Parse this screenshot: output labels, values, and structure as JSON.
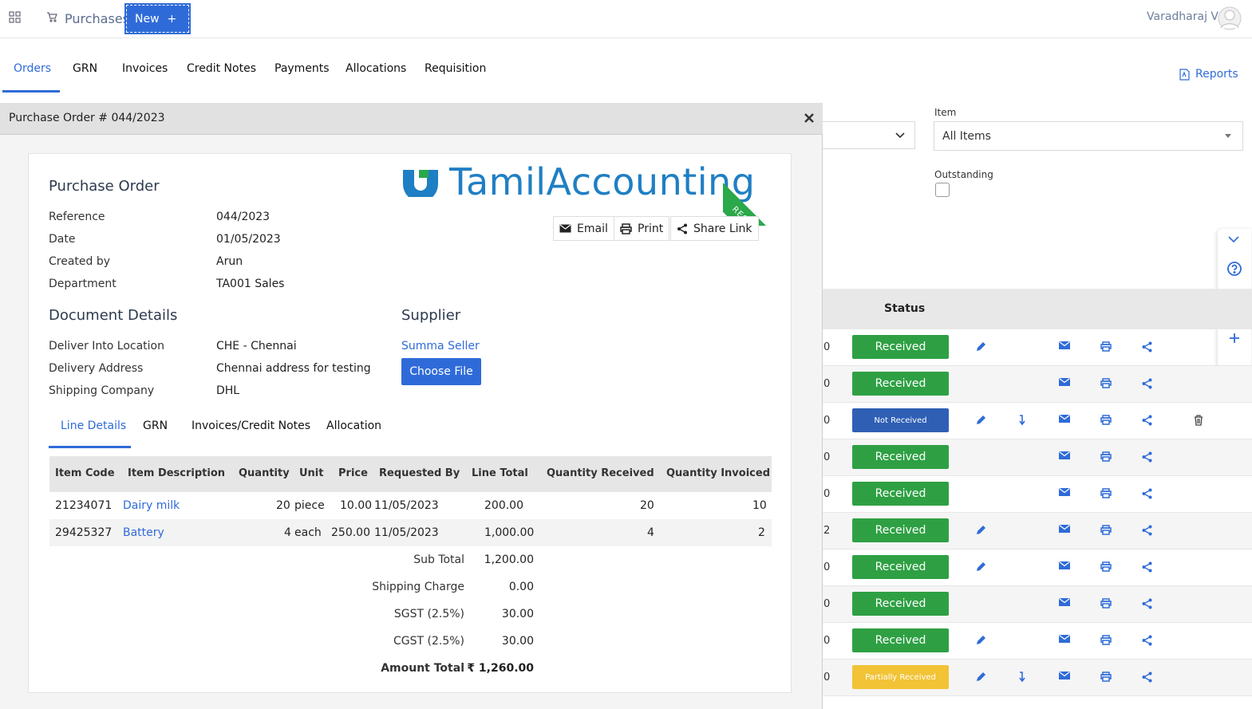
{
  "app": {
    "title": "Purchases",
    "new_label": "New",
    "user_name": "Varadharaj V"
  },
  "main_tabs": [
    {
      "label": "Orders"
    },
    {
      "label": "GRN"
    },
    {
      "label": "Invoices"
    },
    {
      "label": "Credit Notes"
    },
    {
      "label": "Payments"
    },
    {
      "label": "Allocations"
    },
    {
      "label": "Requisition"
    }
  ],
  "reports_label": "Reports",
  "filters": {
    "item_label": "Item",
    "item_value": "All Items",
    "outstanding_label": "Outstanding"
  },
  "list": {
    "status_header": "Status",
    "rows": [
      {
        "num": "0",
        "status": "Received",
        "color": "#2ea043"
      },
      {
        "num": "0",
        "status": "Received",
        "color": "#2ea043"
      },
      {
        "num": "0",
        "status": "Not Received",
        "color": "#2f5fb5"
      },
      {
        "num": "0",
        "status": "Received",
        "color": "#2ea043"
      },
      {
        "num": "0",
        "status": "Received",
        "color": "#2ea043"
      },
      {
        "num": "2",
        "status": "Received",
        "color": "#2ea043"
      },
      {
        "num": "0",
        "status": "Received",
        "color": "#2ea043"
      },
      {
        "num": "0",
        "status": "Received",
        "color": "#2ea043"
      },
      {
        "num": "0",
        "status": "Received",
        "color": "#2ea043"
      },
      {
        "num": "0",
        "status": "Partially Received",
        "color": "#f2c335"
      }
    ]
  },
  "modal": {
    "title": "Purchase Order # 044/2023",
    "logo_text": "TamilAccounting",
    "ribbon_text": "RECEIVED",
    "actions": {
      "email": "Email",
      "print": "Print",
      "share": "Share Link"
    },
    "po_heading": "Purchase Order",
    "po_fields": [
      {
        "label": "Reference",
        "value": "044/2023"
      },
      {
        "label": "Date",
        "value": "01/05/2023"
      },
      {
        "label": "Created by",
        "value": "Arun"
      },
      {
        "label": "Department",
        "value": "TA001 Sales"
      }
    ],
    "doc_heading": "Document Details",
    "doc_fields": [
      {
        "label": "Deliver Into Location",
        "value": "CHE - Chennai"
      },
      {
        "label": "Delivery Address",
        "value": "Chennai address for testing"
      },
      {
        "label": "Shipping Company",
        "value": "DHL"
      }
    ],
    "supplier_heading": "Supplier",
    "supplier_name": "Summa Seller",
    "choose_file": "Choose File",
    "sub_tabs": [
      {
        "label": "Line Details"
      },
      {
        "label": "GRN"
      },
      {
        "label": "Invoices/Credit Notes"
      },
      {
        "label": "Allocation"
      }
    ],
    "table": {
      "headers": {
        "code": "Item Code",
        "desc": "Item Description",
        "qty": "Quantity",
        "unit": "Unit",
        "price": "Price",
        "req_by": "Requested By",
        "total": "Line Total",
        "qty_recv": "Quantity Received",
        "qty_inv": "Quantity Invoiced"
      },
      "rows": [
        {
          "code": "21234071",
          "desc": "Dairy milk",
          "qty": "20",
          "unit": "piece",
          "price": "10.00",
          "req_by": "11/05/2023",
          "total": "200.00",
          "qty_recv": "20",
          "qty_inv": "10"
        },
        {
          "code": "29425327",
          "desc": "Battery",
          "qty": "4",
          "unit": "each",
          "price": "250.00",
          "req_by": "11/05/2023",
          "total": "1,000.00",
          "qty_recv": "4",
          "qty_inv": "2"
        }
      ]
    },
    "totals": [
      {
        "label": "Sub Total",
        "value": "1,200.00"
      },
      {
        "label": "Shipping Charge",
        "value": "0.00"
      },
      {
        "label": "SGST (2.5%)",
        "value": "30.00"
      },
      {
        "label": "CGST (2.5%)",
        "value": "30.00"
      }
    ],
    "amount_total_label": "Amount Total",
    "amount_total_value": "₹ 1,260.00"
  }
}
